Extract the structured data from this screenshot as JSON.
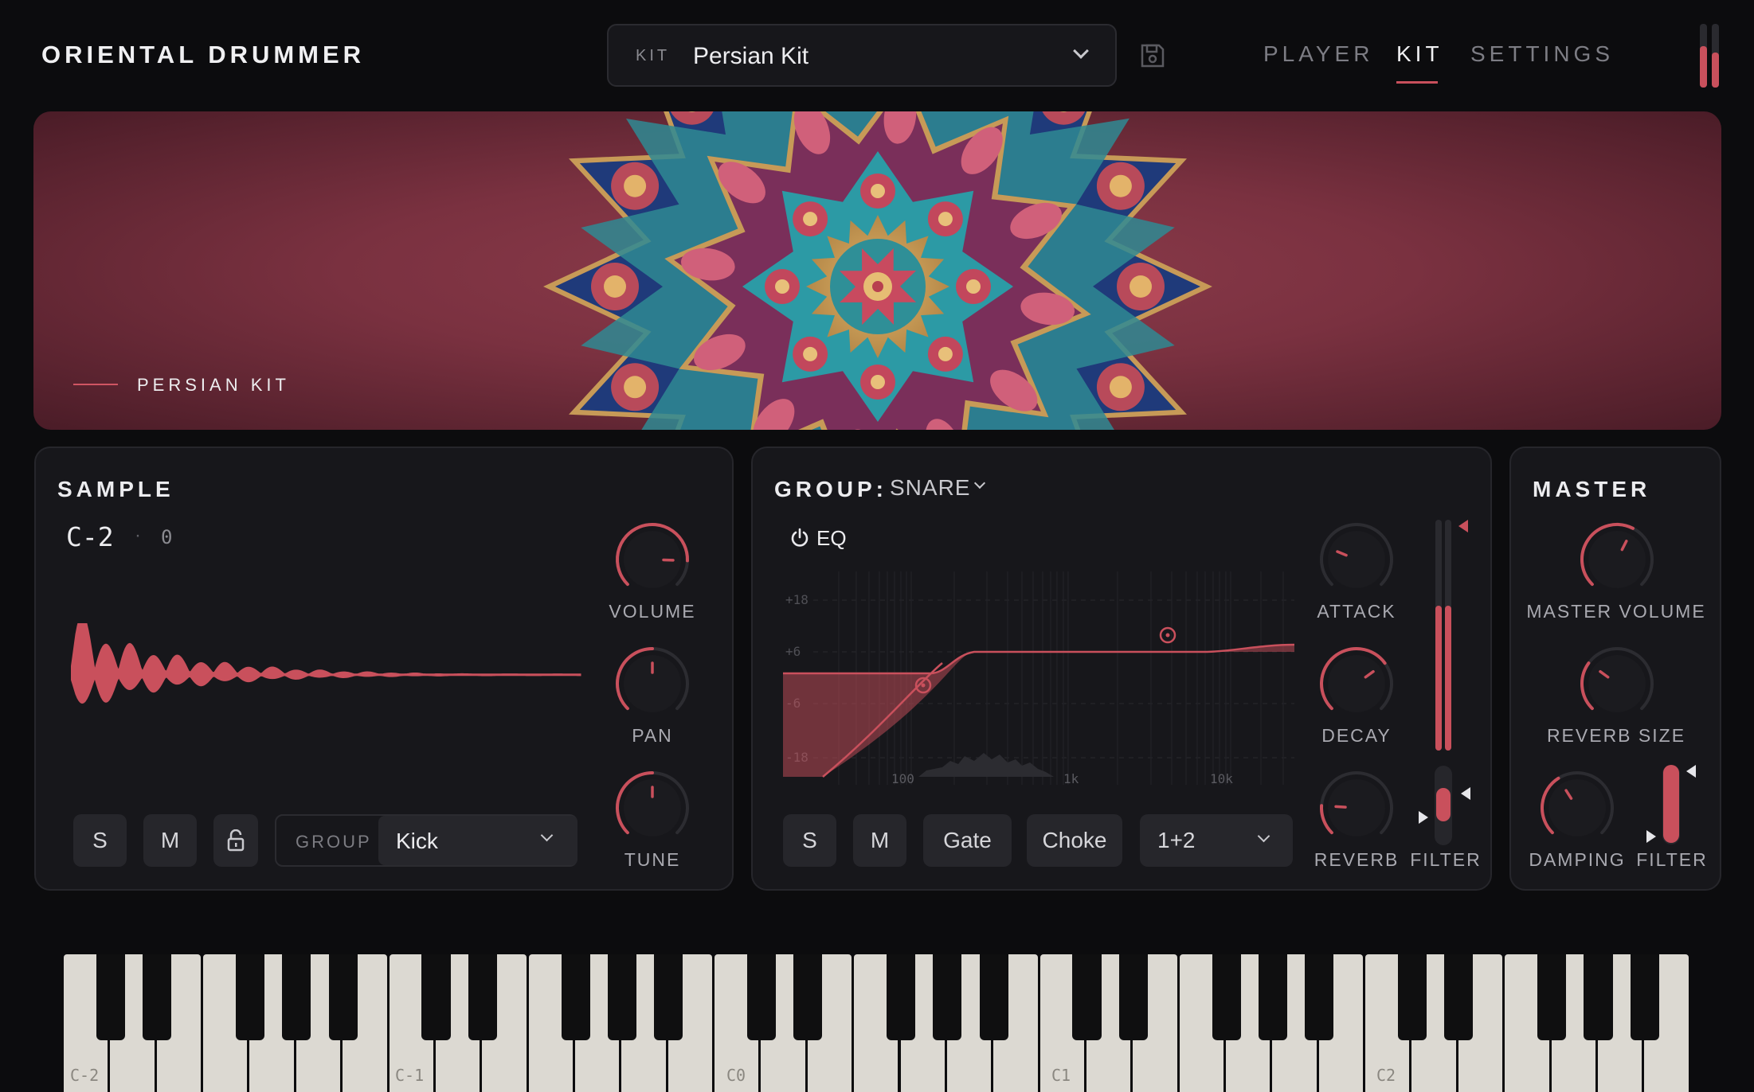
{
  "header": {
    "app_title": "ORIENTAL DRUMMER",
    "kit_selector": {
      "label": "KIT",
      "value": "Persian Kit"
    },
    "nav": {
      "player": "PLAYER",
      "kit": "KIT",
      "settings": "SETTINGS"
    },
    "active_tab": "KIT"
  },
  "banner": {
    "caption": "PERSIAN KIT"
  },
  "sample": {
    "title": "SAMPLE",
    "note": "C-2",
    "separator": "·",
    "velocity": "0",
    "solo": "S",
    "mute": "M",
    "group_label": "GROUP",
    "group_value": "Kick",
    "knobs": {
      "volume": "VOLUME",
      "pan": "PAN",
      "tune": "TUNE"
    }
  },
  "group": {
    "title": "GROUP:",
    "value": "SNARE",
    "eq_label": "EQ",
    "eq_db_labels": [
      "+18",
      "+6",
      "-6",
      "-18"
    ],
    "eq_freq_labels": [
      "100",
      "1k",
      "10k"
    ],
    "solo": "S",
    "mute": "M",
    "gate": "Gate",
    "choke": "Choke",
    "output": "1+2",
    "knobs": {
      "attack": "ATTACK",
      "decay": "DECAY",
      "reverb": "REVERB",
      "filter": "FILTER"
    }
  },
  "master": {
    "title": "MASTER",
    "knobs": {
      "master_volume": "MASTER VOLUME",
      "reverb_size": "REVERB SIZE",
      "damping": "DAMPING",
      "filter": "FILTER"
    }
  },
  "keyboard": {
    "octave_labels": [
      "C-2",
      "C-1",
      "C0",
      "C1",
      "C2"
    ]
  },
  "colors": {
    "accent": "#c9505c",
    "background": "#0c0c0e",
    "panel": "#17171b",
    "white_key": "#dcd9d2",
    "black_key": "#0f0f10"
  }
}
